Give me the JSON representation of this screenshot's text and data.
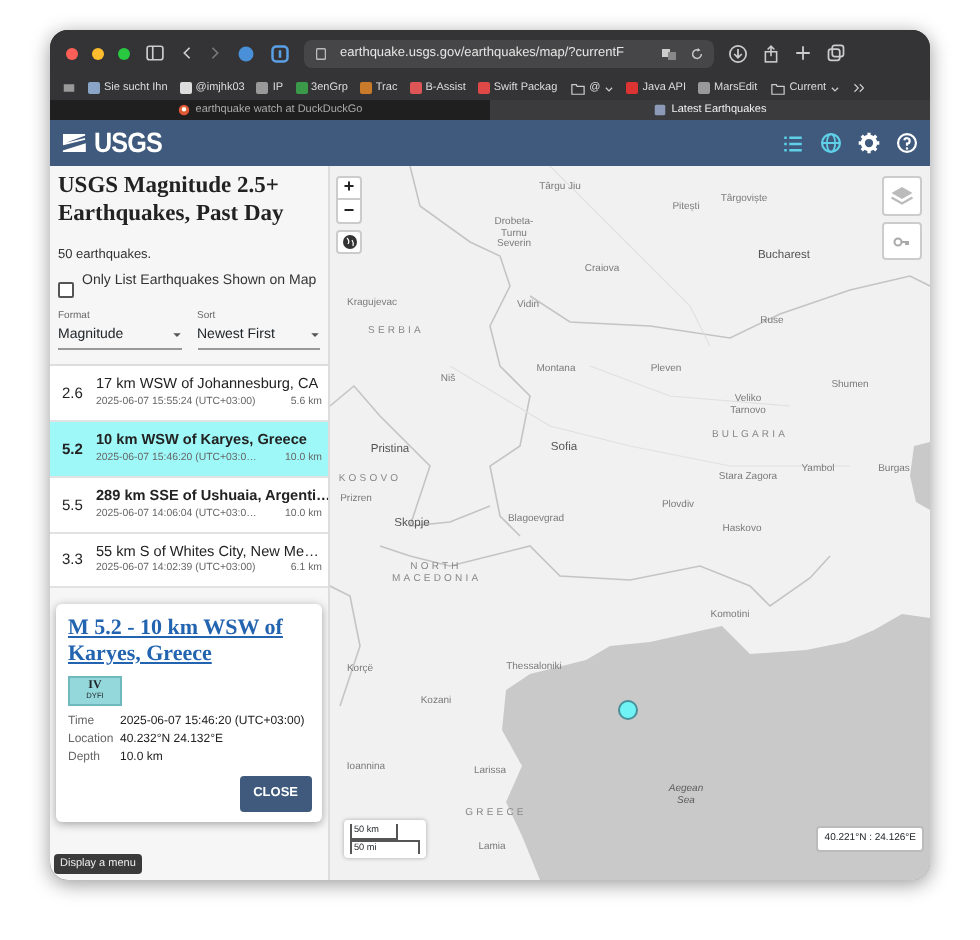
{
  "browser": {
    "url": "earthquake.usgs.gov/earthquakes/map/?currentF",
    "bookmarks": [
      {
        "label": "Sie sucht Ihn",
        "kind": "link"
      },
      {
        "label": "@imjhk03",
        "kind": "link"
      },
      {
        "label": "IP",
        "kind": "link"
      },
      {
        "label": "3enGrp",
        "kind": "link"
      },
      {
        "label": "Trac",
        "kind": "link"
      },
      {
        "label": "B-Assist",
        "kind": "link"
      },
      {
        "label": "Swift Packag",
        "kind": "link"
      },
      {
        "label": "@",
        "kind": "folder"
      },
      {
        "label": "Java API",
        "kind": "link"
      },
      {
        "label": "MarsEdit",
        "kind": "link"
      },
      {
        "label": "Current",
        "kind": "folder"
      }
    ],
    "tabs": [
      {
        "title": "earthquake watch at DuckDuckGo",
        "selected": false
      },
      {
        "title": "Latest Earthquakes",
        "selected": true
      }
    ]
  },
  "header": {
    "logo": "USGS",
    "views": [
      {
        "kind": "list",
        "active": true
      },
      {
        "kind": "map",
        "active": true
      },
      {
        "kind": "settings",
        "active": false
      },
      {
        "kind": "help",
        "active": false
      }
    ]
  },
  "panel": {
    "title": "USGS Magnitude 2.5+ Earthquakes, Past Day",
    "count": "50 earthquakes.",
    "filter": {
      "label": "Only List Earthquakes Shown on Map",
      "checked": false
    },
    "format": {
      "label": "Format",
      "value": "Magnitude"
    },
    "sort": {
      "label": "Sort",
      "value": "Newest First"
    }
  },
  "earthquakes": [
    {
      "mag": "2.6",
      "place": "17 km WSW of Johannesburg, CA",
      "time": "2025-06-07 15:55:24 (UTC+03:00)",
      "depth": "5.6 km",
      "selected": false
    },
    {
      "mag": "5.2",
      "place": "10 km WSW of Karyes, Greece",
      "time": "2025-06-07 15:46:20 (UTC+03:0…",
      "depth": "10.0 km",
      "selected": true
    },
    {
      "mag": "5.5",
      "place": "289 km SSE of Ushuaia, Argenti…",
      "time": "2025-06-07 14:06:04 (UTC+03:0…",
      "depth": "10.0 km",
      "selected": false
    },
    {
      "mag": "3.3",
      "place": "55 km S of Whites City, New Me…",
      "time": "2025-06-07 14:02:39 (UTC+03:00)",
      "depth": "6.1 km",
      "selected": false
    }
  ],
  "popup": {
    "title": "M 5.2 - 10 km WSW of Karyes, Greece",
    "intensity": "IV",
    "intensity_source": "DYFI",
    "fields": [
      {
        "label": "Time",
        "value": "2025-06-07 15:46:20 (UTC+03:00)"
      },
      {
        "label": "Location",
        "value": "40.232°N 24.132°E"
      },
      {
        "label": "Depth",
        "value": "10.0 km"
      }
    ],
    "close": "CLOSE"
  },
  "tooltip": "Display a menu",
  "map": {
    "labels": [
      {
        "text": "Târgu Jiu",
        "kind": "city"
      },
      {
        "text": "Pitești",
        "kind": "city"
      },
      {
        "text": "Târgoviște",
        "kind": "city"
      },
      {
        "text": "Drobeta-Turnu Severin",
        "kind": "city"
      },
      {
        "text": "Craiova",
        "kind": "city"
      },
      {
        "text": "Bucharest",
        "kind": "capital"
      },
      {
        "text": "Kragujevac",
        "kind": "city"
      },
      {
        "text": "SERBIA",
        "kind": "country"
      },
      {
        "text": "Vidin",
        "kind": "city"
      },
      {
        "text": "Ruse",
        "kind": "city"
      },
      {
        "text": "Montana",
        "kind": "city"
      },
      {
        "text": "Pleven",
        "kind": "city"
      },
      {
        "text": "Shumen",
        "kind": "city"
      },
      {
        "text": "Niš",
        "kind": "city"
      },
      {
        "text": "Veliko Tarnovo",
        "kind": "city"
      },
      {
        "text": "BULGARIA",
        "kind": "country"
      },
      {
        "text": "Pristina",
        "kind": "capital"
      },
      {
        "text": "Sofia",
        "kind": "capital"
      },
      {
        "text": "KOSOVO",
        "kind": "country"
      },
      {
        "text": "Prizren",
        "kind": "city"
      },
      {
        "text": "Stara Zagora",
        "kind": "city"
      },
      {
        "text": "Yambol",
        "kind": "city"
      },
      {
        "text": "Burgas",
        "kind": "city"
      },
      {
        "text": "Skopje",
        "kind": "capital"
      },
      {
        "text": "Blagoevgrad",
        "kind": "city"
      },
      {
        "text": "Plovdiv",
        "kind": "city"
      },
      {
        "text": "Haskovo",
        "kind": "city"
      },
      {
        "text": "NORTH MACEDONIA",
        "kind": "country"
      },
      {
        "text": "Komotini",
        "kind": "city"
      },
      {
        "text": "Korçë",
        "kind": "city"
      },
      {
        "text": "Thessaloniki",
        "kind": "city"
      },
      {
        "text": "Kozani",
        "kind": "city"
      },
      {
        "text": "Ioannina",
        "kind": "city"
      },
      {
        "text": "Larissa",
        "kind": "city"
      },
      {
        "text": "GREECE",
        "kind": "country"
      },
      {
        "text": "Aegean Sea",
        "kind": "sea"
      },
      {
        "text": "Lamia",
        "kind": "city"
      }
    ],
    "zoom_in": "+",
    "zoom_out": "−",
    "scale": [
      "50 km",
      "50 mi"
    ],
    "coordinates": "40.221°N : 24.126°E"
  }
}
